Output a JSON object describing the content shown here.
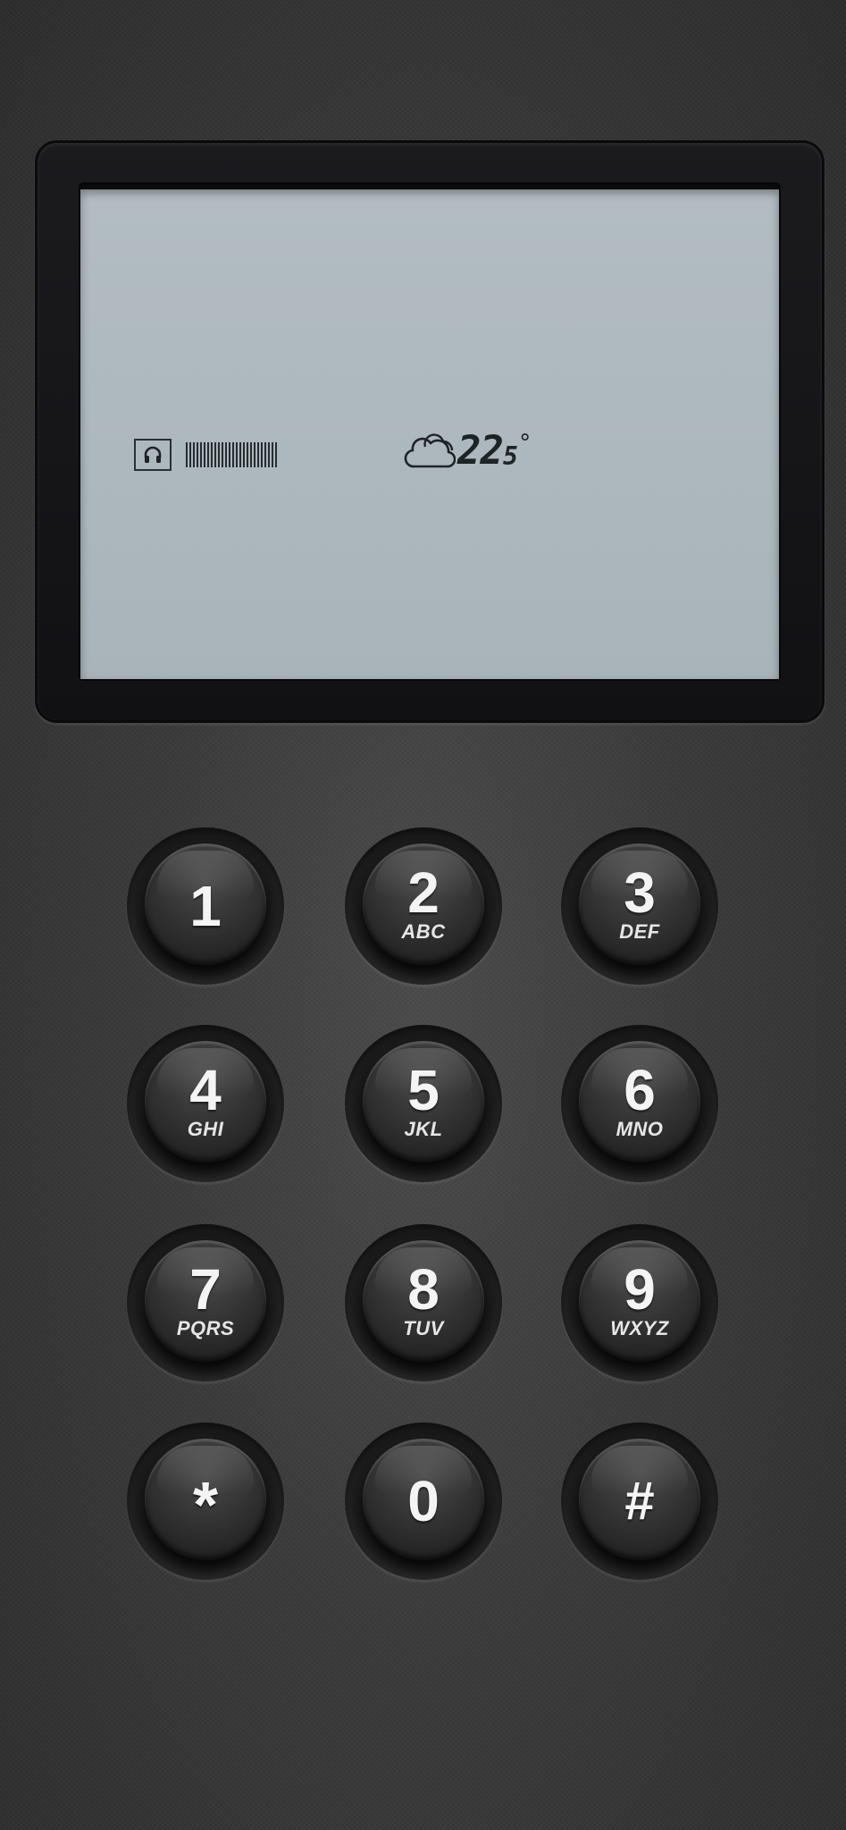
{
  "display": {
    "status_icon": "headset-icon",
    "weather_icon": "cloud-icon",
    "temperature_int": "22",
    "temperature_dec": "5",
    "temperature_unit": "°"
  },
  "keypad": {
    "keys": [
      {
        "digit": "1",
        "letters": ""
      },
      {
        "digit": "2",
        "letters": "ABC"
      },
      {
        "digit": "3",
        "letters": "DEF"
      },
      {
        "digit": "4",
        "letters": "GHI"
      },
      {
        "digit": "5",
        "letters": "JKL"
      },
      {
        "digit": "6",
        "letters": "MNO"
      },
      {
        "digit": "7",
        "letters": "PQRS"
      },
      {
        "digit": "8",
        "letters": "TUV"
      },
      {
        "digit": "9",
        "letters": "WXYZ"
      },
      {
        "digit": "*",
        "letters": ""
      },
      {
        "digit": "0",
        "letters": ""
      },
      {
        "digit": "#",
        "letters": ""
      }
    ]
  }
}
